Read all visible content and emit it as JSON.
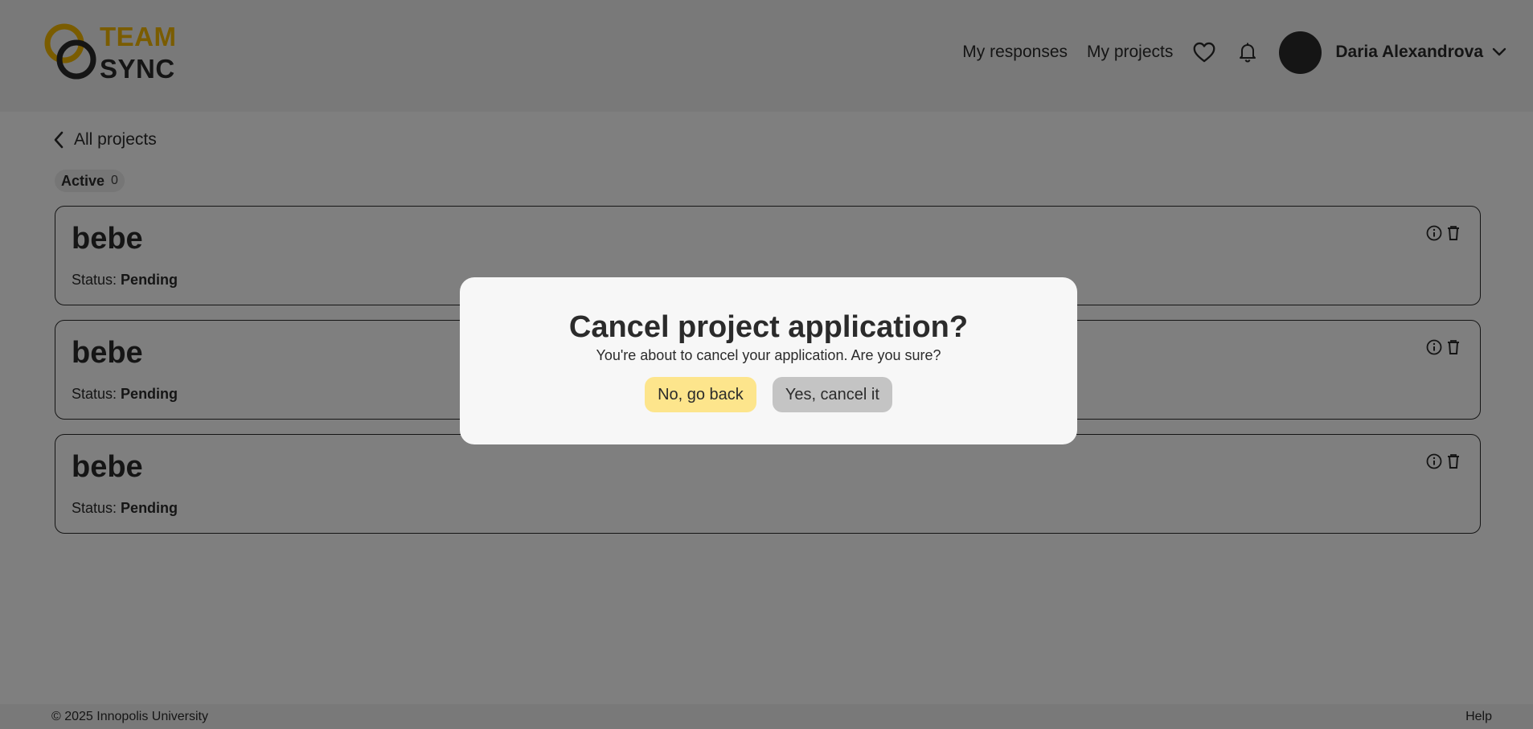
{
  "brand": {
    "line1": "TEAM",
    "line2": "SYNC",
    "accent_color": "#f5b800"
  },
  "nav": {
    "responses_label": "My responses",
    "projects_label": "My projects",
    "favorites_icon": "heart-icon",
    "notifications_icon": "bell-icon",
    "user_name": "Daria Alexandrova",
    "user_menu_icon": "chevron-down-icon"
  },
  "back": {
    "label": "All projects",
    "icon": "chevron-left-icon"
  },
  "tabs": [
    {
      "label": "Active",
      "count": "0"
    }
  ],
  "projects": [
    {
      "title": "bebe",
      "status_label": "Status:",
      "status_value": "Pending"
    },
    {
      "title": "bebe",
      "status_label": "Status:",
      "status_value": "Pending"
    },
    {
      "title": "bebe",
      "status_label": "Status:",
      "status_value": "Pending"
    }
  ],
  "footer": {
    "copyright": "© 2025 Innopolis University",
    "help": "Help"
  },
  "modal": {
    "title": "Cancel project application?",
    "message": "You're about to cancel your application. Are you sure?",
    "no_label": "No, go back",
    "yes_label": "Yes, cancel it"
  },
  "colors": {
    "no_button": "#fde58c",
    "yes_button": "#c4c4c4",
    "overlay": "rgba(0,0,0,0.5)"
  }
}
